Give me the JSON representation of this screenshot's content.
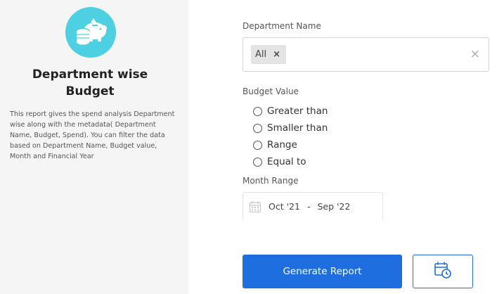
{
  "report": {
    "title_line1": "Department wise",
    "title_line2": "Budget",
    "description": "This report gives the spend analysis Department wise along with the metadata( Department Name, Budget, Spend). You can filter the data based on Department Name, Budget value, Month and Financial Year",
    "icon": "piggy-bank-coins-icon"
  },
  "filters": {
    "department": {
      "label": "Department Name",
      "selected_chip": "All",
      "chip_remove": "×",
      "clear_all": "×"
    },
    "budget": {
      "label": "Budget Value",
      "options": [
        "Greater than",
        "Smaller than",
        "Range",
        "Equal to"
      ]
    },
    "month_range": {
      "label": "Month Range",
      "start": "Oct '21",
      "separator": "-",
      "end": "Sep '22",
      "icon": "calendar-icon"
    }
  },
  "actions": {
    "generate_label": "Generate Report",
    "schedule_icon": "calendar-clock-icon"
  },
  "colors": {
    "accent": "#1e6ee0",
    "logo_bg": "#4dd0e1",
    "panel_bg": "#f5f5f5"
  }
}
